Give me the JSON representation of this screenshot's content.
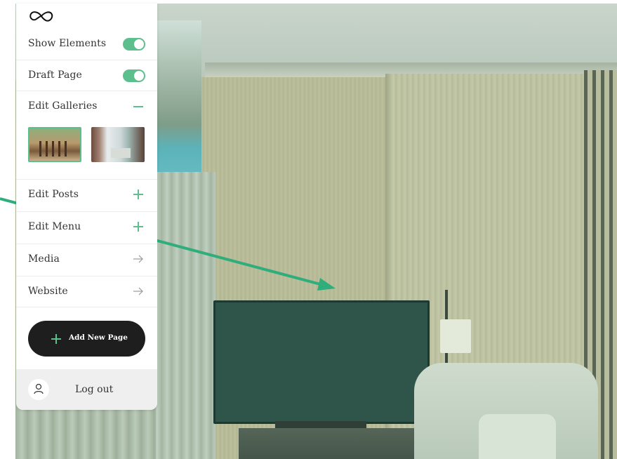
{
  "app": {
    "logo_icon": "infinity-icon",
    "accent_color": "#5dbe8e",
    "dark_button_color": "#1e1e1e"
  },
  "menu": {
    "show_elements": {
      "label": "Show Elements",
      "toggle_on": true,
      "icon": "toggle-switch"
    },
    "draft_page": {
      "label": "Draft Page",
      "toggle_on": true,
      "icon": "toggle-switch"
    },
    "edit_galleries": {
      "label": "Edit Galleries",
      "icon": "minus-icon",
      "expanded": true
    },
    "edit_posts": {
      "label": "Edit Posts",
      "icon": "plus-icon"
    },
    "edit_menu": {
      "label": "Edit Menu",
      "icon": "plus-icon"
    },
    "media": {
      "label": "Media",
      "icon": "arrow-right-icon"
    },
    "website": {
      "label": "Website",
      "icon": "arrow-right-icon"
    }
  },
  "gallery": {
    "thumbnails": [
      {
        "icon": "patio-photo",
        "selected": true
      },
      {
        "icon": "bedroom-window-photo",
        "selected": false
      }
    ]
  },
  "actions": {
    "add_new_page": "Add New Page",
    "add_icon": "plus-icon"
  },
  "footer": {
    "logout_label": "Log out",
    "avatar_icon": "user-icon"
  }
}
